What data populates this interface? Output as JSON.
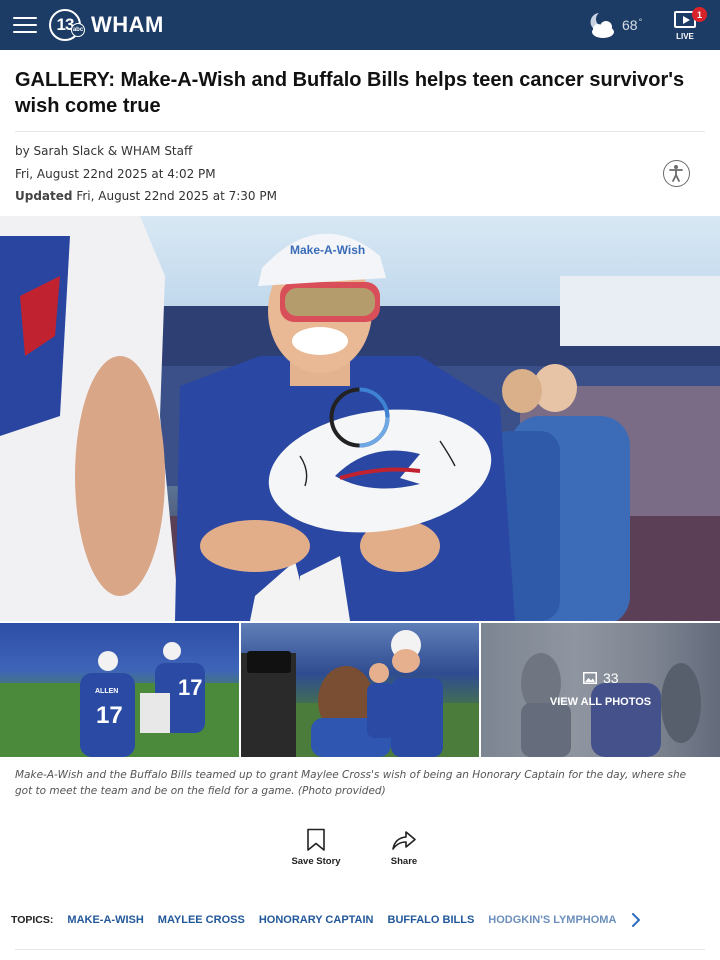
{
  "header": {
    "menu_icon": "hamburger-menu-icon",
    "logo": {
      "number": "13",
      "network": "abc",
      "name": "WHAM"
    },
    "weather": {
      "icon": "moon-cloud-icon",
      "temperature": "68",
      "degree_symbol": "°"
    },
    "live": {
      "icon": "play-screen-icon",
      "badge_count": "1",
      "label": "LIVE"
    }
  },
  "article": {
    "title": "GALLERY: Make-A-Wish and Buffalo Bills helps teen cancer survivor's wish come true",
    "byline": "by Sarah Slack & WHAM Staff",
    "published": "Fri, August 22nd 2025 at 4:02 PM",
    "updated_label": "Updated",
    "updated": "Fri, August 22nd 2025 at 7:30 PM",
    "accessibility_icon": "accessibility-person-icon"
  },
  "gallery": {
    "photo_count": "33",
    "view_all_label": "VIEW ALL PHOTOS",
    "caption": "Make-A-Wish and the Buffalo Bills teamed up to grant Maylee Cross's wish of being an Honorary Captain for the day, where she got to meet the team and be on the field for a game. (Photo provided)",
    "hero": {
      "cap_text": "Make-A-Wish"
    },
    "thumb1": {
      "jersey_name": "ALLEN",
      "jersey_number": "17"
    }
  },
  "actions": {
    "save_label": "Save Story",
    "share_label": "Share"
  },
  "topics": {
    "label": "TOPICS:",
    "items": [
      "MAKE-A-WISH",
      "MAYLEE CROSS",
      "HONORARY CAPTAIN",
      "BUFFALO BILLS",
      "HODGKIN'S LYMPHOMA"
    ]
  },
  "colors": {
    "header_bg": "#1c3c66",
    "topic_link": "#22589a",
    "live_badge": "#d8232a"
  }
}
